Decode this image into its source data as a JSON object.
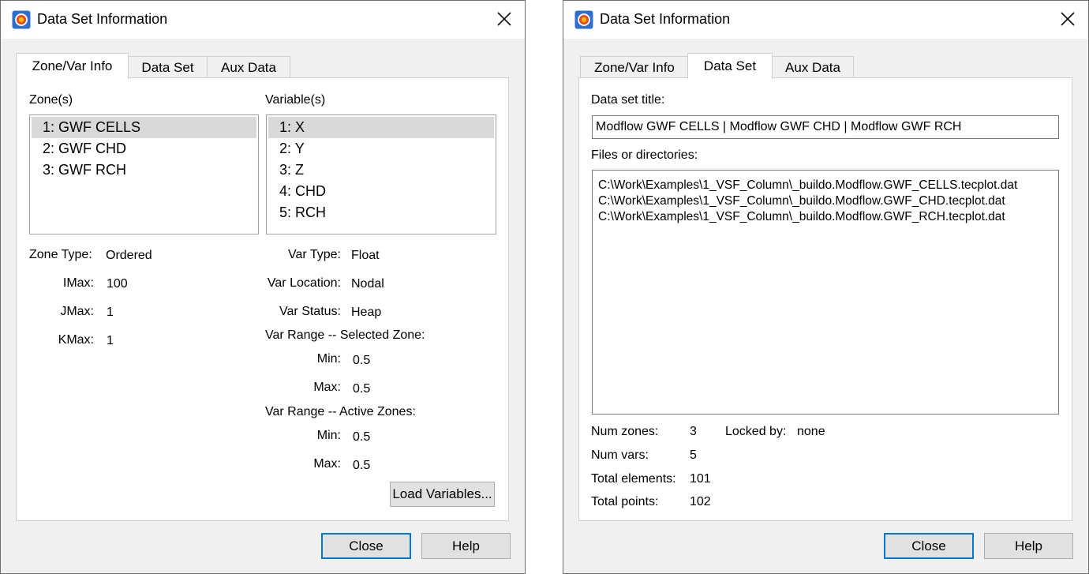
{
  "left": {
    "title": "Data Set Information",
    "tabs": [
      "Zone/Var Info",
      "Data Set",
      "Aux Data"
    ],
    "zones_label": "Zone(s)",
    "zones": [
      "1: GWF CELLS",
      "2: GWF CHD",
      "3: GWF RCH"
    ],
    "vars_label": "Variable(s)",
    "variables": [
      "1: X",
      "2: Y",
      "3: Z",
      "4: CHD",
      "5: RCH"
    ],
    "zone_type_label": "Zone Type:",
    "zone_type": "Ordered",
    "imax_label": "IMax:",
    "imax": "100",
    "jmax_label": "JMax:",
    "jmax": "1",
    "kmax_label": "KMax:",
    "kmax": "1",
    "var_type_label": "Var Type:",
    "var_type": "Float",
    "var_location_label": "Var Location:",
    "var_location": "Nodal",
    "var_status_label": "Var Status:",
    "var_status": "Heap",
    "range_selected_label": "Var Range -- Selected Zone:",
    "sel_min_label": "Min:",
    "sel_min": "0.5",
    "sel_max_label": "Max:",
    "sel_max": "0.5",
    "range_active_label": "Var Range -- Active Zones:",
    "act_min_label": "Min:",
    "act_min": "0.5",
    "act_max_label": "Max:",
    "act_max": "0.5",
    "load_variables": "Load Variables...",
    "close": "Close",
    "help": "Help"
  },
  "right": {
    "title": "Data Set Information",
    "tabs": [
      "Zone/Var Info",
      "Data Set",
      "Aux Data"
    ],
    "dataset_title_label": "Data set title:",
    "dataset_title": "Modflow GWF CELLS | Modflow GWF CHD | Modflow GWF RCH",
    "files_label": "Files or directories:",
    "files": [
      "C:\\Work\\Examples\\1_VSF_Column\\_buildo.Modflow.GWF_CELLS.tecplot.dat",
      "C:\\Work\\Examples\\1_VSF_Column\\_buildo.Modflow.GWF_CHD.tecplot.dat",
      "C:\\Work\\Examples\\1_VSF_Column\\_buildo.Modflow.GWF_RCH.tecplot.dat"
    ],
    "num_zones_label": "Num zones:",
    "num_zones": "3",
    "locked_by_label": "Locked by:",
    "locked_by": "none",
    "num_vars_label": "Num vars:",
    "num_vars": "5",
    "total_elements_label": "Total elements:",
    "total_elements": "101",
    "total_points_label": "Total points:",
    "total_points": "102",
    "close": "Close",
    "help": "Help"
  }
}
